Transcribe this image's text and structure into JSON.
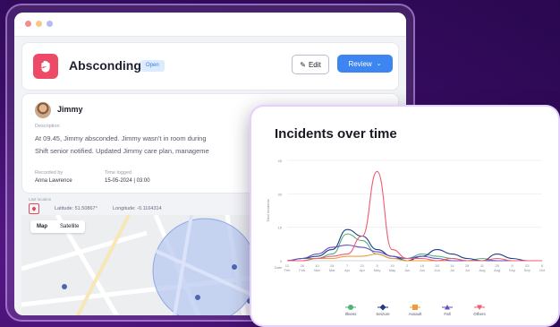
{
  "header": {
    "title": "Absconding",
    "status": "Open",
    "edit_label": "Edit",
    "review_label": "Review"
  },
  "incident": {
    "person": "Jimmy",
    "description_label": "Description",
    "description_lines": [
      "At 09.45, Jimmy absconded. Jimmy wasn't in room during",
      "Shift senior notified. Updated Jimmy care plan, manageme"
    ],
    "recorded_by_label": "Recorded by",
    "recorded_by": "Anna Lawrence",
    "time_logged_label": "Time logged",
    "time_logged": "15-05-2024  |  03:00"
  },
  "location": {
    "label": "Last location",
    "latitude_text": "Latitude: 51.50867°",
    "longitude_text": "Longitude: -0.1164314",
    "map_tab": "Map",
    "satellite_tab": "Satellite"
  },
  "chart_data": {
    "type": "line",
    "title": "Incidents over time",
    "ylabel": "Total Incidents",
    "ylim": [
      0,
      45
    ],
    "yticks": [
      0,
      15,
      30,
      45
    ],
    "x": [
      "Feb",
      "Mar",
      "Mar",
      "Mar",
      "Apr",
      "Apr",
      "Apr",
      "Apr",
      "May",
      "May",
      "May",
      "May",
      "Jun",
      "Jun",
      "Jun",
      "Jun",
      "Jul",
      "Jul"
    ],
    "x_day_labels": [
      "12",
      "26",
      "10",
      "24",
      "7",
      "21",
      "5",
      "19",
      "2",
      "16",
      "30",
      "14",
      "28",
      "11",
      "25",
      "9",
      "23",
      "6"
    ],
    "x_month_labels": [
      "Feb",
      "Feb",
      "Mar",
      "Mar",
      "Apr",
      "Apr",
      "May",
      "May",
      "Jun",
      "Jun",
      "Jun",
      "Jul",
      "Jul",
      "Aug",
      "Aug",
      "Sep",
      "Sep",
      "Oct"
    ],
    "x_first_label": "Date",
    "series": [
      {
        "name": "Illness",
        "color": "#4fb27a",
        "values": [
          0,
          1,
          1,
          3,
          12,
          9,
          3,
          1,
          1,
          3,
          2,
          1,
          0,
          1,
          0,
          0,
          0,
          0
        ]
      },
      {
        "name": "Seizure",
        "color": "#1f3a8a",
        "values": [
          0,
          1,
          2,
          5,
          14,
          11,
          5,
          2,
          0,
          2,
          5,
          3,
          1,
          0,
          3,
          1,
          0,
          0
        ]
      },
      {
        "name": "Assault",
        "color": "#f39a3a",
        "values": [
          0,
          0,
          1,
          1,
          2,
          2,
          3,
          1,
          0,
          0,
          0,
          0,
          0,
          0,
          0,
          0,
          0,
          0
        ]
      },
      {
        "name": "Fall",
        "color": "#6a4fc2",
        "values": [
          0,
          1,
          3,
          6,
          7,
          6,
          4,
          2,
          1,
          2,
          1,
          0,
          0,
          0,
          0,
          0,
          0,
          0
        ]
      },
      {
        "name": "Others",
        "color": "#ef5a6e",
        "values": [
          0,
          0,
          1,
          2,
          3,
          11,
          40,
          5,
          1,
          1,
          0,
          1,
          0,
          0,
          1,
          0,
          0,
          0
        ]
      }
    ],
    "grid": true,
    "legend": "bottom"
  }
}
